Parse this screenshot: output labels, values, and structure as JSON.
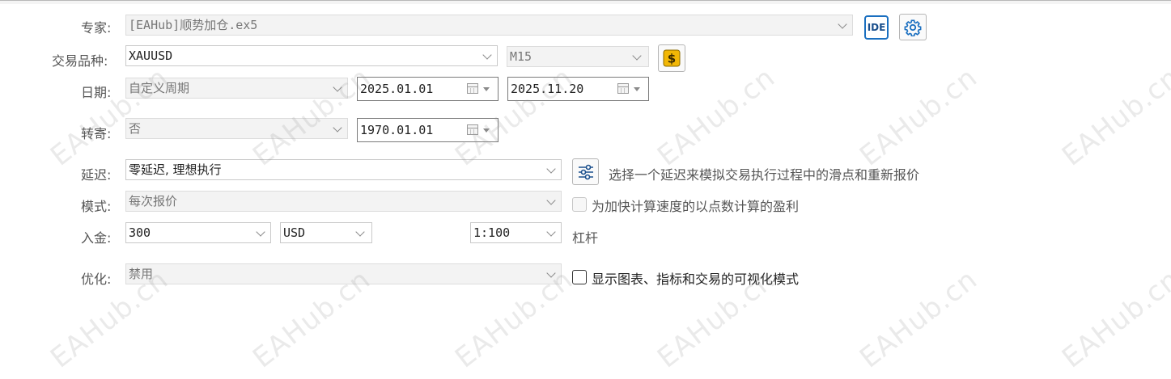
{
  "labels": {
    "expert": "专家:",
    "symbol": "交易品种:",
    "date": "日期:",
    "forward": "转寄:",
    "delay": "延迟:",
    "mode": "模式:",
    "deposit": "入金:",
    "optimization": "优化:"
  },
  "expert": {
    "value": "[EAHub]顺势加仓.ex5",
    "ide_button": "IDE",
    "settings_icon": "gear-icon"
  },
  "symbol": {
    "value": "XAUUSD",
    "timeframe": "M15",
    "symbol_icon": "dollar-icon"
  },
  "date": {
    "period": "自定义周期",
    "from": "2025.01.01",
    "to": "2025.11.20"
  },
  "forward": {
    "value": "否",
    "date": "1970.01.01"
  },
  "delay": {
    "value": "零延迟, 理想执行",
    "settings_icon": "sliders-icon",
    "description": "选择一个延迟来模拟交易执行过程中的滑点和重新报价"
  },
  "mode": {
    "value": "每次报价",
    "checkbox_label": "为加快计算速度的以点数计算的盈利",
    "checkbox_checked": false
  },
  "deposit": {
    "amount": "300",
    "currency": "USD",
    "leverage": "1:100",
    "leverage_label": "杠杆"
  },
  "optimization": {
    "value": "禁用",
    "checkbox_label": "显示图表、指标和交易的可视化模式",
    "checkbox_checked": false
  },
  "watermark": "EAHub.cn",
  "colors": {
    "accent": "#1a6fc0",
    "dollar_bg": "#f2b705",
    "disabled_bg": "#f3f3f3"
  }
}
